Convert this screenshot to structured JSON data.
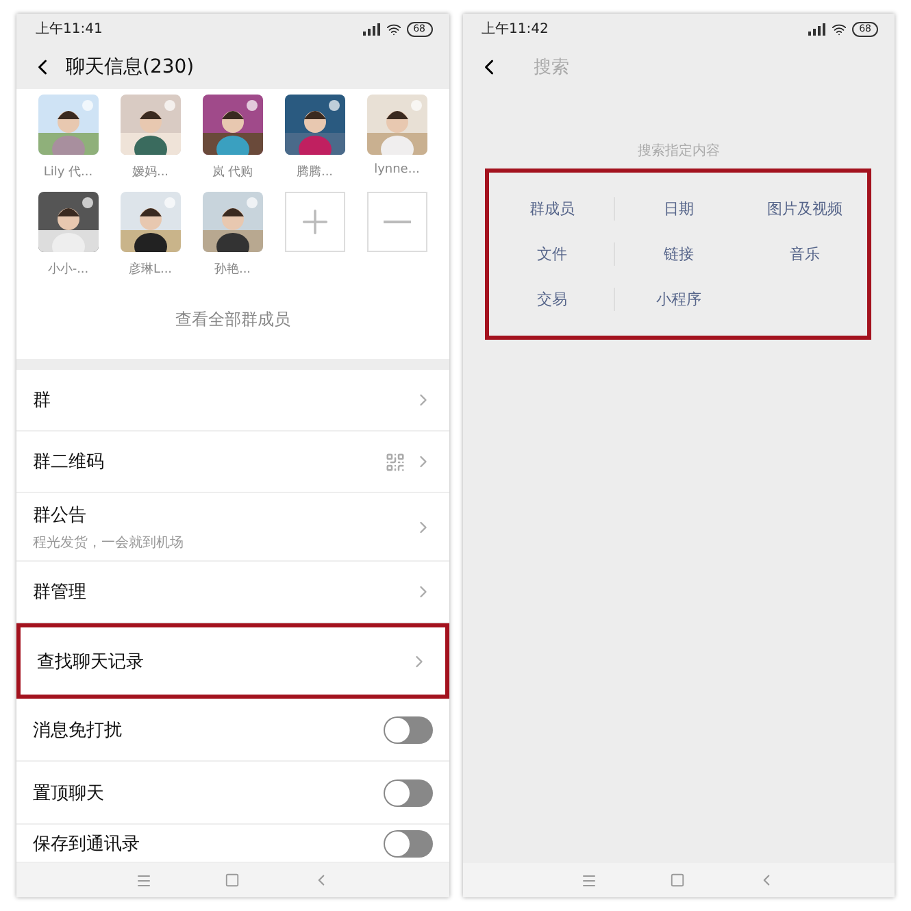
{
  "left": {
    "status": {
      "time": "上午11:41",
      "battery": "68"
    },
    "title": "聊天信息(230)",
    "members": [
      {
        "name": "Lily 代..."
      },
      {
        "name": "嫒妈..."
      },
      {
        "name": "岚 代购"
      },
      {
        "name": "腾腾..."
      },
      {
        "name": "lynne..."
      },
      {
        "name": "小小-..."
      },
      {
        "name": "彦琳L..."
      },
      {
        "name": "孙艳..."
      }
    ],
    "view_all": "查看全部群成员",
    "rows": [
      {
        "kind": "link",
        "label": "群",
        "highlighted": false
      },
      {
        "kind": "qr",
        "label": "群二维码",
        "highlighted": false
      },
      {
        "kind": "link",
        "label": "群公告",
        "subtitle": "程光发货，一会就到机场",
        "highlighted": false
      },
      {
        "kind": "link",
        "label": "群管理",
        "highlighted": false
      },
      {
        "kind": "link",
        "label": "查找聊天记录",
        "highlighted": true
      },
      {
        "kind": "toggle",
        "label": "消息免打扰",
        "on": false,
        "highlighted": false
      },
      {
        "kind": "toggle",
        "label": "置顶聊天",
        "on": false,
        "highlighted": false
      },
      {
        "kind": "toggle",
        "label": "保存到通讯录",
        "on": false,
        "highlighted": false
      }
    ]
  },
  "right": {
    "status": {
      "time": "上午11:42",
      "battery": "68"
    },
    "search": {
      "placeholder": "搜索"
    },
    "hint": "搜索指定内容",
    "highlighted": true,
    "categories": [
      {
        "label": "群成员"
      },
      {
        "label": "日期"
      },
      {
        "label": "图片及视频"
      },
      {
        "label": "文件"
      },
      {
        "label": "链接"
      },
      {
        "label": "音乐"
      },
      {
        "label": "交易"
      },
      {
        "label": "小程序"
      }
    ]
  }
}
